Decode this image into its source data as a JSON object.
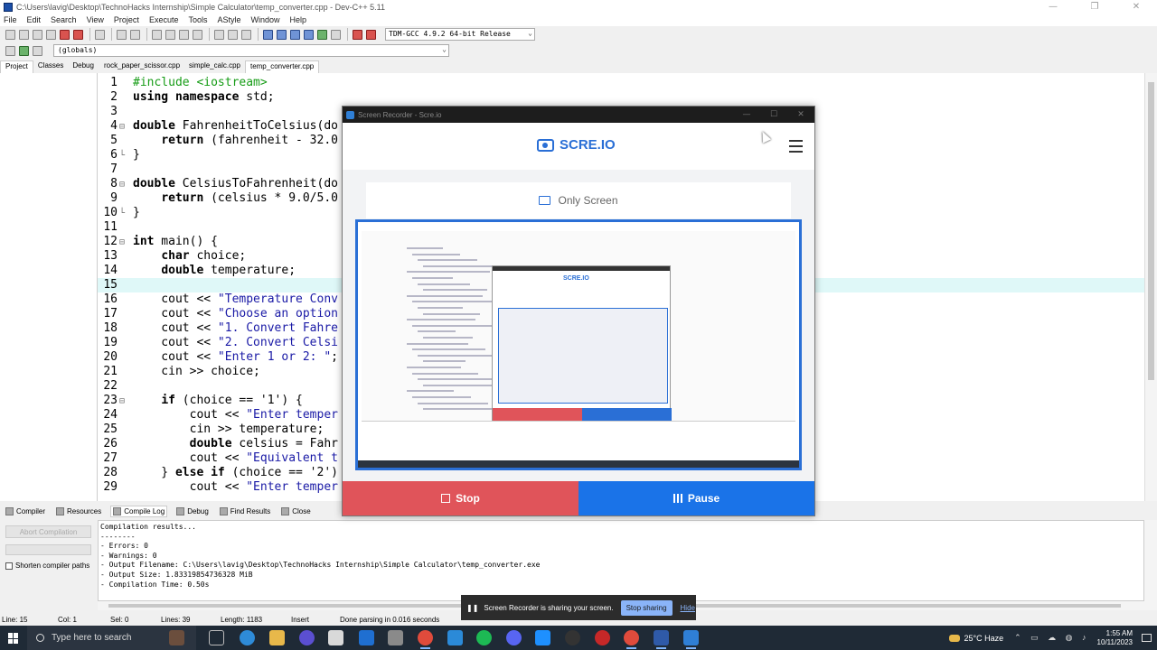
{
  "window": {
    "title": "C:\\Users\\lavig\\Desktop\\TechnoHacks Internship\\Simple Calculator\\temp_converter.cpp - Dev-C++ 5.11"
  },
  "menu": [
    "File",
    "Edit",
    "Search",
    "View",
    "Project",
    "Execute",
    "Tools",
    "AStyle",
    "Window",
    "Help"
  ],
  "toolbar": {
    "compiler": "TDM-GCC 4.9.2 64-bit Release",
    "scope": "(globals)"
  },
  "left_tabs": [
    "Project",
    "Classes",
    "Debug"
  ],
  "file_tabs": [
    "rock_paper_scissor.cpp",
    "simple_calc.cpp",
    "temp_converter.cpp"
  ],
  "editor": {
    "highlighted_line": 15,
    "lines": [
      {
        "n": "1",
        "fold": "",
        "code": "#include <iostream>"
      },
      {
        "n": "2",
        "fold": "",
        "code": "using namespace std;"
      },
      {
        "n": "3",
        "fold": "",
        "code": ""
      },
      {
        "n": "4",
        "fold": "⊟",
        "code": "double FahrenheitToCelsius(do"
      },
      {
        "n": "5",
        "fold": "",
        "code": "    return (fahrenheit - 32.0"
      },
      {
        "n": "6",
        "fold": "└",
        "code": "}"
      },
      {
        "n": "7",
        "fold": "",
        "code": ""
      },
      {
        "n": "8",
        "fold": "⊟",
        "code": "double CelsiusToFahrenheit(do"
      },
      {
        "n": "9",
        "fold": "",
        "code": "    return (celsius * 9.0/5.0"
      },
      {
        "n": "10",
        "fold": "└",
        "code": "}"
      },
      {
        "n": "11",
        "fold": "",
        "code": ""
      },
      {
        "n": "12",
        "fold": "⊟",
        "code": "int main() {"
      },
      {
        "n": "13",
        "fold": "",
        "code": "    char choice;"
      },
      {
        "n": "14",
        "fold": "",
        "code": "    double temperature;"
      },
      {
        "n": "15",
        "fold": "",
        "code": ""
      },
      {
        "n": "16",
        "fold": "",
        "code": "    cout << \"Temperature Conv"
      },
      {
        "n": "17",
        "fold": "",
        "code": "    cout << \"Choose an option"
      },
      {
        "n": "18",
        "fold": "",
        "code": "    cout << \"1. Convert Fahre"
      },
      {
        "n": "19",
        "fold": "",
        "code": "    cout << \"2. Convert Celsi"
      },
      {
        "n": "20",
        "fold": "",
        "code": "    cout << \"Enter 1 or 2: \";"
      },
      {
        "n": "21",
        "fold": "",
        "code": "    cin >> choice;"
      },
      {
        "n": "22",
        "fold": "",
        "code": ""
      },
      {
        "n": "23",
        "fold": "⊟",
        "code": "    if (choice == '1') {"
      },
      {
        "n": "24",
        "fold": "",
        "code": "        cout << \"Enter temper"
      },
      {
        "n": "25",
        "fold": "",
        "code": "        cin >> temperature;"
      },
      {
        "n": "26",
        "fold": "",
        "code": "        double celsius = Fahr"
      },
      {
        "n": "27",
        "fold": "",
        "code": "        cout << \"Equivalent t"
      },
      {
        "n": "28",
        "fold": "",
        "code": "    } else if (choice == '2')"
      },
      {
        "n": "29",
        "fold": "",
        "code": "        cout << \"Enter temper"
      }
    ]
  },
  "bottom_tabs": [
    "Compiler",
    "Resources",
    "Compile Log",
    "Debug",
    "Find Results",
    "Close"
  ],
  "compile_panel": {
    "abort_label": "Abort Compilation",
    "shorten_label": "Shorten compiler paths",
    "log": "Compilation results...\n--------\n- Errors: 0\n- Warnings: 0\n- Output Filename: C:\\Users\\lavig\\Desktop\\TechnoHacks Internship\\Simple Calculator\\temp_converter.exe\n- Output Size: 1.83319854736328 MiB\n- Compilation Time: 0.50s"
  },
  "status": {
    "line": "Line:   15",
    "col": "Col:    1",
    "sel": "Sel:    0",
    "lines": "Lines:   39",
    "length": "Length:  1183",
    "mode": "Insert",
    "message": "Done parsing in 0.016 seconds"
  },
  "recorder": {
    "title": "Screen Recorder - Scre.io",
    "logo": "SCRE.IO",
    "mode": "Only Screen",
    "stop_label": "Stop",
    "pause_label": "Pause",
    "preview_logo": "SCRE.IO"
  },
  "share_bar": {
    "message": "Screen Recorder is sharing your screen.",
    "stop_label": "Stop sharing",
    "hide_label": "Hide"
  },
  "taskbar": {
    "search_placeholder": "Type here to search",
    "weather": "25°C  Haze",
    "time": "1:55 AM",
    "date": "10/11/2023"
  },
  "colors": {
    "accent_blue": "#1a73e8",
    "stop_red": "#e0545a",
    "highlight_line": "#dff8f8"
  }
}
